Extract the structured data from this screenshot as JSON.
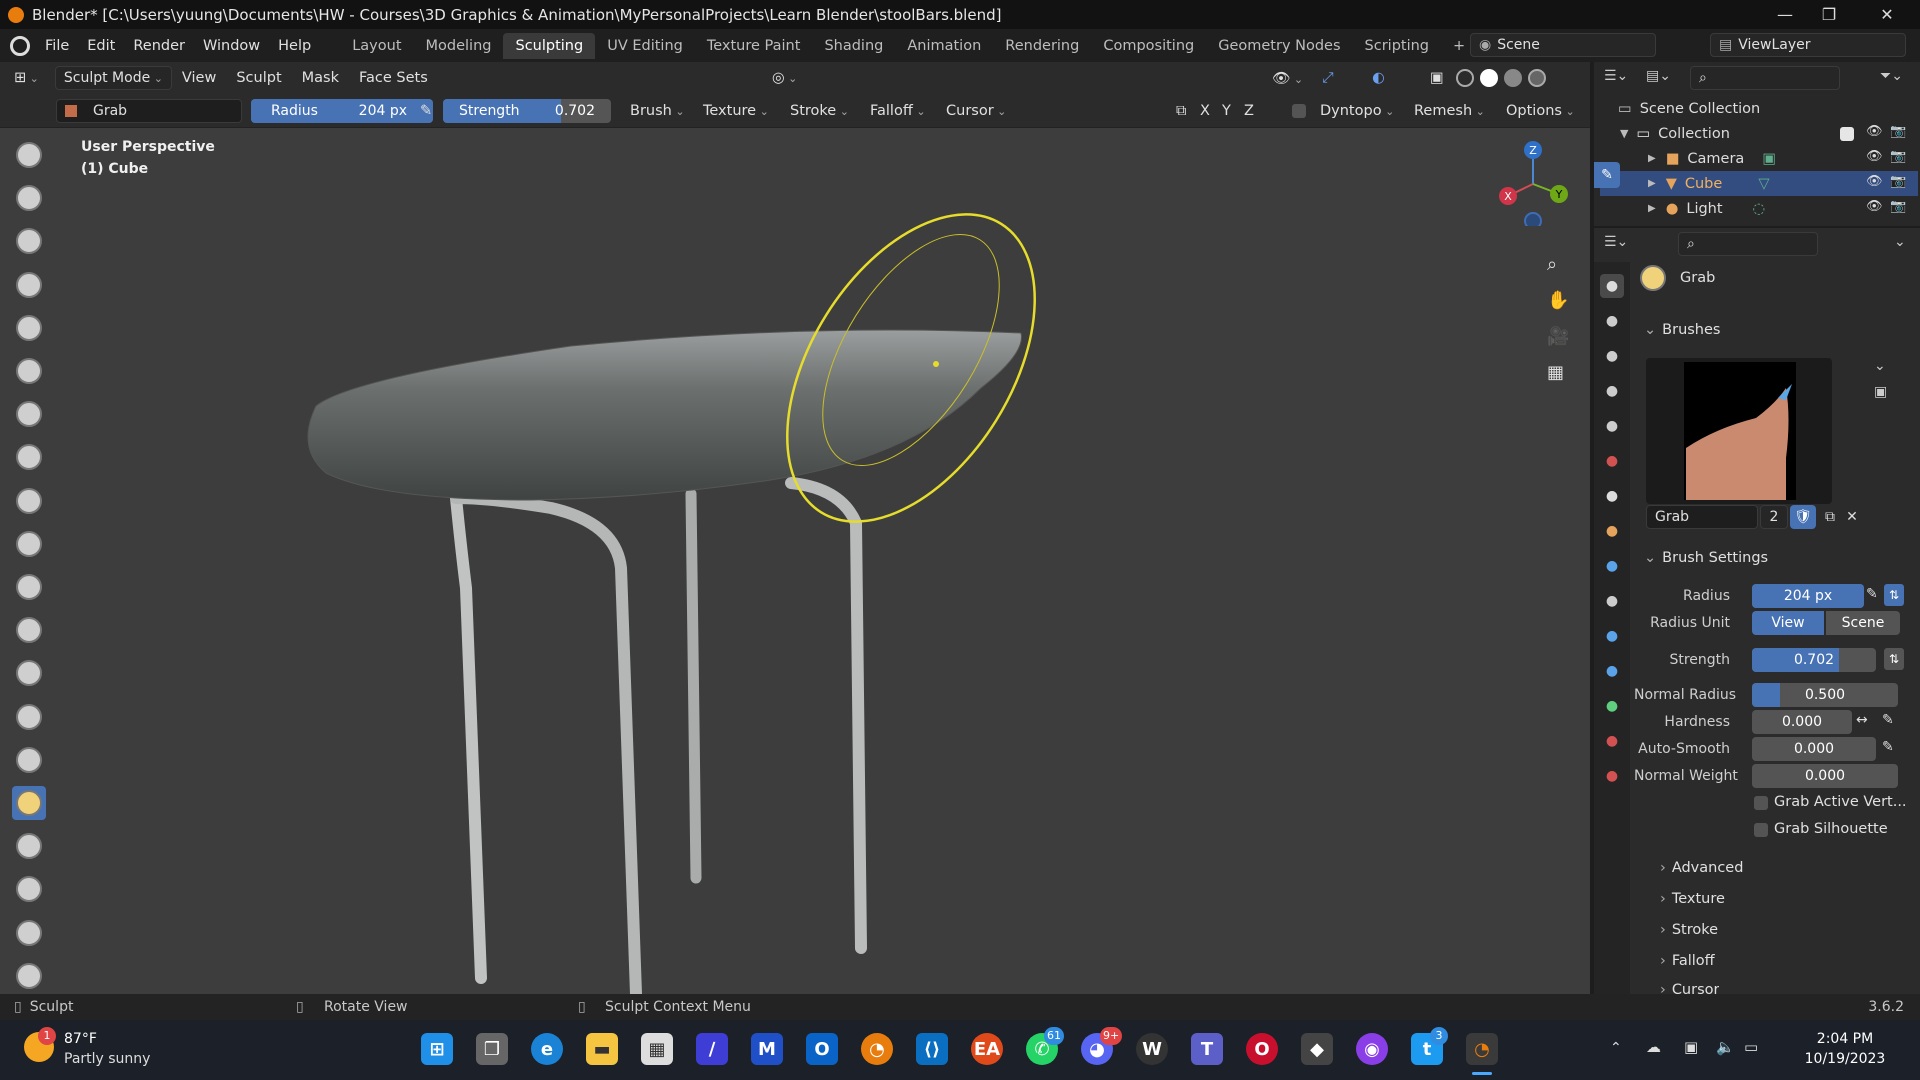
{
  "titlebar": {
    "title": "Blender* [C:\\Users\\yuung\\Documents\\HW - Courses\\3D Graphics & Animation\\MyPersonalProjects\\Learn Blender\\stoolBars.blend]",
    "minimize": "—",
    "maximize": "❐",
    "close": "✕"
  },
  "menubar": {
    "menus": [
      "File",
      "Edit",
      "Render",
      "Window",
      "Help"
    ],
    "workspaces": [
      "Layout",
      "Modeling",
      "Sculpting",
      "UV Editing",
      "Texture Paint",
      "Shading",
      "Animation",
      "Rendering",
      "Compositing",
      "Geometry Nodes",
      "Scripting"
    ],
    "active_workspace": "Sculpting",
    "add_tab": "+",
    "scene": "Scene",
    "view_layer": "ViewLayer"
  },
  "header1": {
    "mode": "Sculpt Mode",
    "menus": [
      "View",
      "Sculpt",
      "Mask",
      "Face Sets"
    ]
  },
  "header2": {
    "brush_name": "Grab",
    "radius_label": "Radius",
    "radius_value": "204 px",
    "strength_label": "Strength",
    "strength_value": "0.702",
    "strength_fraction": 0.702,
    "dropdowns": [
      "Brush",
      "Texture",
      "Stroke",
      "Falloff",
      "Cursor"
    ],
    "axes": [
      "X",
      "Y",
      "Z"
    ],
    "dyntopo": "Dyntopo",
    "remesh": "Remesh",
    "options": "Options"
  },
  "viewport": {
    "perspective": "User Perspective",
    "object": "(1) Cube",
    "gizmo_axes": [
      "Z",
      "X",
      "Y"
    ]
  },
  "outliner": {
    "scene_collection": "Scene Collection",
    "collection": "Collection",
    "items": [
      "Camera",
      "Cube",
      "Light"
    ],
    "selected": "Cube"
  },
  "properties": {
    "brush_header": "Grab",
    "brushes_section": "Brushes",
    "brush_slot_name": "Grab",
    "brush_users": "2",
    "brush_settings_section": "Brush Settings",
    "radius_label": "Radius",
    "radius_value": "204 px",
    "radius_unit_label": "Radius Unit",
    "radius_unit_view": "View",
    "radius_unit_scene": "Scene",
    "strength_label": "Strength",
    "strength_value": "0.702",
    "strength_fraction": 0.702,
    "normal_radius_label": "Normal Radius",
    "normal_radius_value": "0.500",
    "normal_radius_fraction": 0.5,
    "hardness_label": "Hardness",
    "hardness_value": "0.000",
    "auto_smooth_label": "Auto-Smooth",
    "auto_smooth_value": "0.000",
    "normal_weight_label": "Normal Weight",
    "normal_weight_value": "0.000",
    "grab_active_vertex": "Grab Active Vert...",
    "grab_silhouette": "Grab Silhouette",
    "subsections": [
      "Advanced",
      "Texture",
      "Stroke",
      "Falloff",
      "Cursor"
    ]
  },
  "statusbar": {
    "left_action": "Sculpt",
    "middle_action": "Rotate View",
    "right_action": "Sculpt Context Menu",
    "version": "3.6.2"
  },
  "taskbar": {
    "weather_temp": "87°F",
    "weather_desc": "Partly sunny",
    "weather_badge": "1",
    "whatsapp_badge": "61",
    "discord_badge": "9+",
    "twitter_badge": "3",
    "time": "2:04 PM",
    "date": "10/19/2023"
  },
  "colors": {
    "accent": "#4772b3",
    "brush_circle": "#e6dc2c",
    "viewport_bg": "#3d3d3d",
    "blender_orange": "#e87d0d"
  }
}
